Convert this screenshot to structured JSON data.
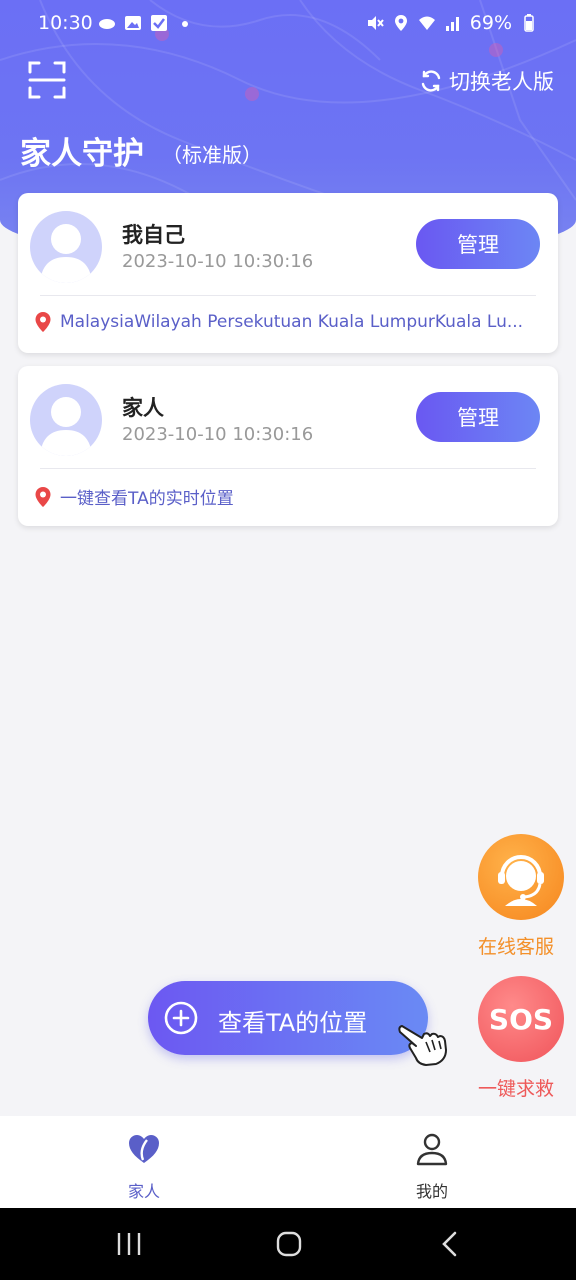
{
  "status_bar": {
    "time": "10:30",
    "battery": "69%"
  },
  "header": {
    "switch_label": "切换老人版",
    "title": "家人守护",
    "subtitle": "（标准版）"
  },
  "cards": [
    {
      "name": "我自己",
      "timestamp": "2023-10-10 10:30:16",
      "manage_label": "管理",
      "location": "MalaysiaWilayah Persekutuan Kuala LumpurKuala Lu..."
    },
    {
      "name": "家人",
      "timestamp": "2023-10-10 10:30:16",
      "manage_label": "管理",
      "location": "一键查看TA的实时位置"
    }
  ],
  "floating": {
    "service_label": "在线客服",
    "sos_text": "SOS",
    "sos_label": "一键求救",
    "view_location_label": "查看TA的位置"
  },
  "tabbar": {
    "tabs": [
      {
        "label": "家人",
        "active": true
      },
      {
        "label": "我的",
        "active": false
      }
    ]
  },
  "colors": {
    "accent": "#6b6ff5",
    "tab_active": "#5a5fc8",
    "service": "#f3902a",
    "sos": "#ee5a5a"
  }
}
